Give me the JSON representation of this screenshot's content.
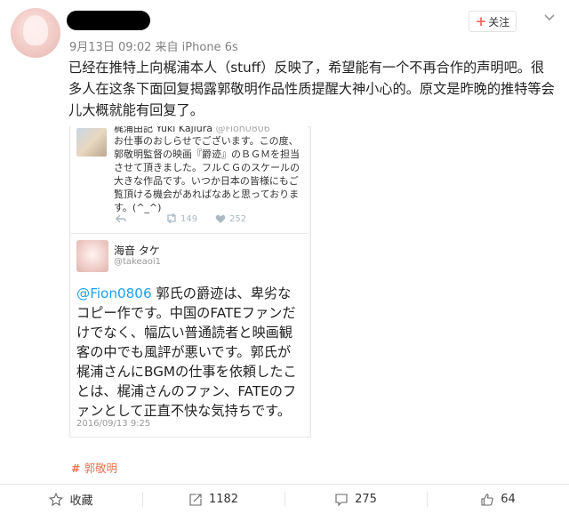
{
  "post": {
    "meta": "9月13日 09:02 来自 iPhone 6s",
    "follow_label": "关注",
    "text": "已经在推特上向梶浦本人（stuff）反映了，希望能有一个不再合作的声明吧。很多人在这条下面回复揭露郭敬明作品性质提醒大神小心的。原文是昨晚的推特等会儿大概就能有回复了。",
    "tag": "郭敬明"
  },
  "tweet1": {
    "name": "梶浦由記 Yuki Kajiura",
    "handle": "@Fion0806",
    "text": "お仕事のおしらせでございます。この度、郭敬明監督の映画『爵迹』のＢＧＭを担当させて頂きました。フルＣＧのスケールの大きな作品です。いつか日本の皆様にもご覧頂ける機会があればなあと思っております。(^_^)",
    "retweets": "149",
    "likes": "252"
  },
  "tweet2": {
    "name": "海音 タケ",
    "handle": "@takeaoi1",
    "mention": "@Fion0806",
    "text": " 郭氏の爵迹は、卑劣なコピー作です。中国のFATEファンだけでなく、幅広い普通読者と映画観客の中でも風評が悪いです。郭氏が梶浦さんにBGMの仕事を依頼したことは、梶浦さんのファン、FATEのファンとして正直不快な気持ちです。",
    "date": "2016/09/13 9:25"
  },
  "actions": {
    "favorite": "收藏",
    "repost": "1182",
    "comment": "275",
    "like": "64"
  }
}
